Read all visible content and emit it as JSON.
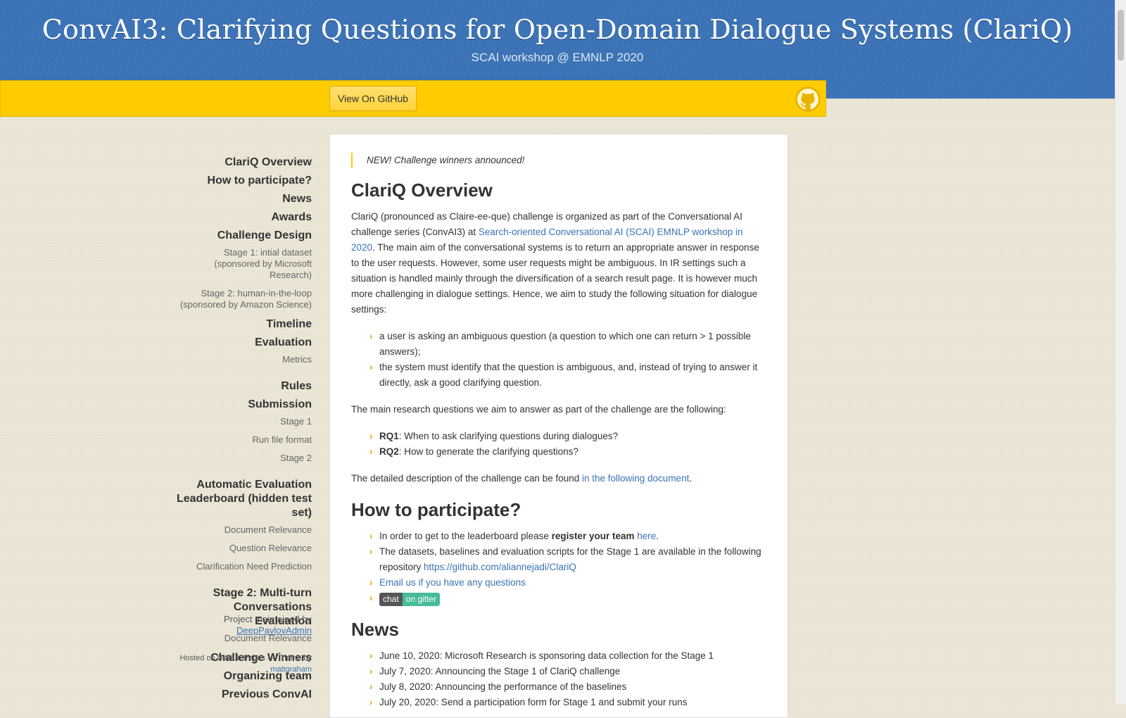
{
  "header": {
    "title": "ConvAI3: Clarifying Questions for Open-Domain Dialogue Systems (ClariQ)",
    "subtitle": "SCAI workshop @ EMNLP 2020"
  },
  "banner": {
    "github_button": "View On GitHub",
    "logo_icon": "github-icon"
  },
  "sidebar": {
    "items": [
      {
        "label": "ClariQ Overview",
        "level": 1
      },
      {
        "label": "How to participate?",
        "level": 1
      },
      {
        "label": "News",
        "level": 1
      },
      {
        "label": "Awards",
        "level": 1
      },
      {
        "label": "Challenge Design",
        "level": 1
      },
      {
        "label": "Stage 1: intial dataset (sponsored by Microsoft Research)",
        "level": 2
      },
      {
        "label": "Stage 2: human-in-the-loop (sponsored by Amazon Science)",
        "level": 2
      },
      {
        "label": "Timeline",
        "level": 1
      },
      {
        "label": "Evaluation",
        "level": 1
      },
      {
        "label": "Metrics",
        "level": 2
      },
      {
        "label": "Rules",
        "level": 1
      },
      {
        "label": "Submission",
        "level": 1
      },
      {
        "label": "Stage 1",
        "level": 2
      },
      {
        "label": "Run file format",
        "level": 2
      },
      {
        "label": "Stage 2",
        "level": 2
      },
      {
        "label": "Automatic Evaluation Leaderboard (hidden test set)",
        "level": 1
      },
      {
        "label": "Document Relevance",
        "level": 2
      },
      {
        "label": "Question Relevance",
        "level": 2
      },
      {
        "label": "Clarification Need Prediction",
        "level": 2
      },
      {
        "label": "Stage 2: Multi-turn Conversations Evaluation",
        "level": 1
      },
      {
        "label": "Document Relevance",
        "level": 2
      },
      {
        "label": "Challenge Winners",
        "level": 1
      },
      {
        "label": "Organizing team",
        "level": 1
      },
      {
        "label": "Previous ConvAI",
        "level": 1
      }
    ],
    "footer": {
      "maintained_prefix": "Project maintained by",
      "maintainer": "DeepPavlovAdmin",
      "hosted_text": "Hosted on GitHub Pages — Theme by",
      "theme_author": "mattgraham"
    }
  },
  "content": {
    "notice": "NEW! Challenge winners announced!",
    "overview": {
      "heading": "ClariQ Overview",
      "p1_a": "ClariQ (pronounced as Claire-ee-que) challenge is organized as part of the Conversational AI challenge series (ConvAI3) at ",
      "p1_link": "Search-oriented Conversational AI (SCAI) EMNLP workshop in 2020",
      "p1_b": ". The main aim of the conversational systems is to return an appropriate answer in response to the user requests. However, some user requests might be ambiguous. In IR settings such a situation is handled mainly through the diversification of a search result page. It is however much more challenging in dialogue settings. Hence, we aim to study the following situation for dialogue settings:",
      "list1": [
        "a user is asking an ambiguous question (a question to which one can return > 1 possible answers);",
        "the system must identify that the question is ambiguous, and, instead of trying to answer it directly, ask a good clarifying question."
      ],
      "p2": "The main research questions we aim to answer as part of the challenge are the following:",
      "rq1_label": "RQ1",
      "rq1_text": ": When to ask clarifying questions during dialogues?",
      "rq2_label": "RQ2",
      "rq2_text": ": How to generate the clarifying questions?",
      "p3_a": "The detailed description of the challenge can be found ",
      "p3_link": "in the following document",
      "p3_b": "."
    },
    "participate": {
      "heading": "How to participate?",
      "i1_a": "In order to get to the leaderboard please ",
      "i1_bold": "register your team",
      "i1_sp": " ",
      "i1_link": "here",
      "i1_b": ".",
      "i2_a": "The datasets, baselines and evaluation scripts for the Stage 1 are available in the following repository ",
      "i2_link": "https://github.com/aliannejadi/ClariQ",
      "i3_link": "Email us if you have any questions",
      "badge_left": "chat",
      "badge_right": "on gitter"
    },
    "news": {
      "heading": "News",
      "items": [
        "June 10, 2020: Microsoft Research is sponsoring data collection for the Stage 1",
        "July 7, 2020: Announcing the Stage 1 of ClariQ challenge",
        "July 8, 2020: Announcing the performance of the baselines",
        "July 20, 2020: Send a participation form for Stage 1 and submit your runs"
      ]
    }
  }
}
